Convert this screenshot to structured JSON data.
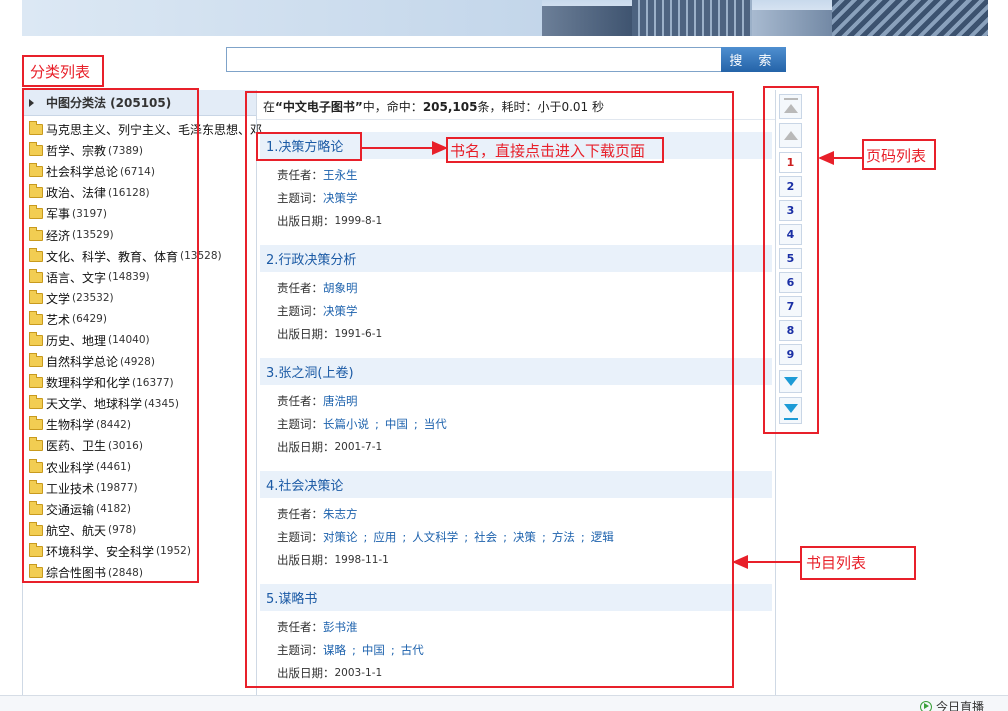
{
  "search": {
    "button_label": "搜 索",
    "value": ""
  },
  "category_panel": {
    "header": "中图分类法 (205105)",
    "items": [
      {
        "label": "马克思主义、列宁主义、毛泽东思想、邓",
        "count": ""
      },
      {
        "label": "哲学、宗教",
        "count": "(7389)"
      },
      {
        "label": "社会科学总论",
        "count": "(6714)"
      },
      {
        "label": "政治、法律",
        "count": "(16128)"
      },
      {
        "label": "军事",
        "count": "(3197)"
      },
      {
        "label": "经济",
        "count": "(13529)"
      },
      {
        "label": "文化、科学、教育、体育",
        "count": "(13528)"
      },
      {
        "label": "语言、文字",
        "count": "(14839)"
      },
      {
        "label": "文学",
        "count": "(23532)"
      },
      {
        "label": "艺术",
        "count": "(6429)"
      },
      {
        "label": "历史、地理",
        "count": "(14040)"
      },
      {
        "label": "自然科学总论",
        "count": "(4928)"
      },
      {
        "label": "数理科学和化学",
        "count": "(16377)"
      },
      {
        "label": "天文学、地球科学",
        "count": "(4345)"
      },
      {
        "label": "生物科学",
        "count": "(8442)"
      },
      {
        "label": "医药、卫生",
        "count": "(3016)"
      },
      {
        "label": "农业科学",
        "count": "(4461)"
      },
      {
        "label": "工业技术",
        "count": "(19877)"
      },
      {
        "label": "交通运输",
        "count": "(4182)"
      },
      {
        "label": "航空、航天",
        "count": "(978)"
      },
      {
        "label": "环境科学、安全科学",
        "count": "(1952)"
      },
      {
        "label": "综合性图书",
        "count": "(2848)"
      }
    ]
  },
  "results": {
    "summary_prefix": "在",
    "summary_scope": "“中文电子图书”",
    "summary_mid": "中，命中：",
    "summary_hits": "205,105",
    "summary_suffix": "条，耗时：小于0.01 秒",
    "labels": {
      "author": "责任者：",
      "subject": "主题词：",
      "date": "出版日期："
    },
    "books": [
      {
        "title": "1.决策方略论",
        "author": "王永生",
        "subjects": [
          "决策学"
        ],
        "date": "1999-8-1"
      },
      {
        "title": "2.行政决策分析",
        "author": "胡象明",
        "subjects": [
          "决策学"
        ],
        "date": "1991-6-1"
      },
      {
        "title": "3.张之洞(上卷)",
        "author": "唐浩明",
        "subjects": [
          "长篇小说",
          "中国",
          "当代"
        ],
        "date": "2001-7-1"
      },
      {
        "title": "4.社会决策论",
        "author": "朱志方",
        "subjects": [
          "对策论",
          "应用",
          "人文科学",
          "社会",
          "决策",
          "方法",
          "逻辑"
        ],
        "date": "1998-11-1"
      },
      {
        "title": "5.谋略书",
        "author": "彭书淮",
        "subjects": [
          "谋略",
          "中国",
          "古代"
        ],
        "date": "2003-1-1"
      }
    ]
  },
  "pagination": {
    "current": "1",
    "pages": [
      "1",
      "2",
      "3",
      "4",
      "5",
      "6",
      "7",
      "8",
      "9"
    ]
  },
  "annotations": {
    "category_list": "分类列表",
    "book_title_hint": "书名，直接点击进入下载页面",
    "page_list": "页码列表",
    "book_list": "书目列表"
  },
  "footer": {
    "live_label": "今日直播"
  }
}
